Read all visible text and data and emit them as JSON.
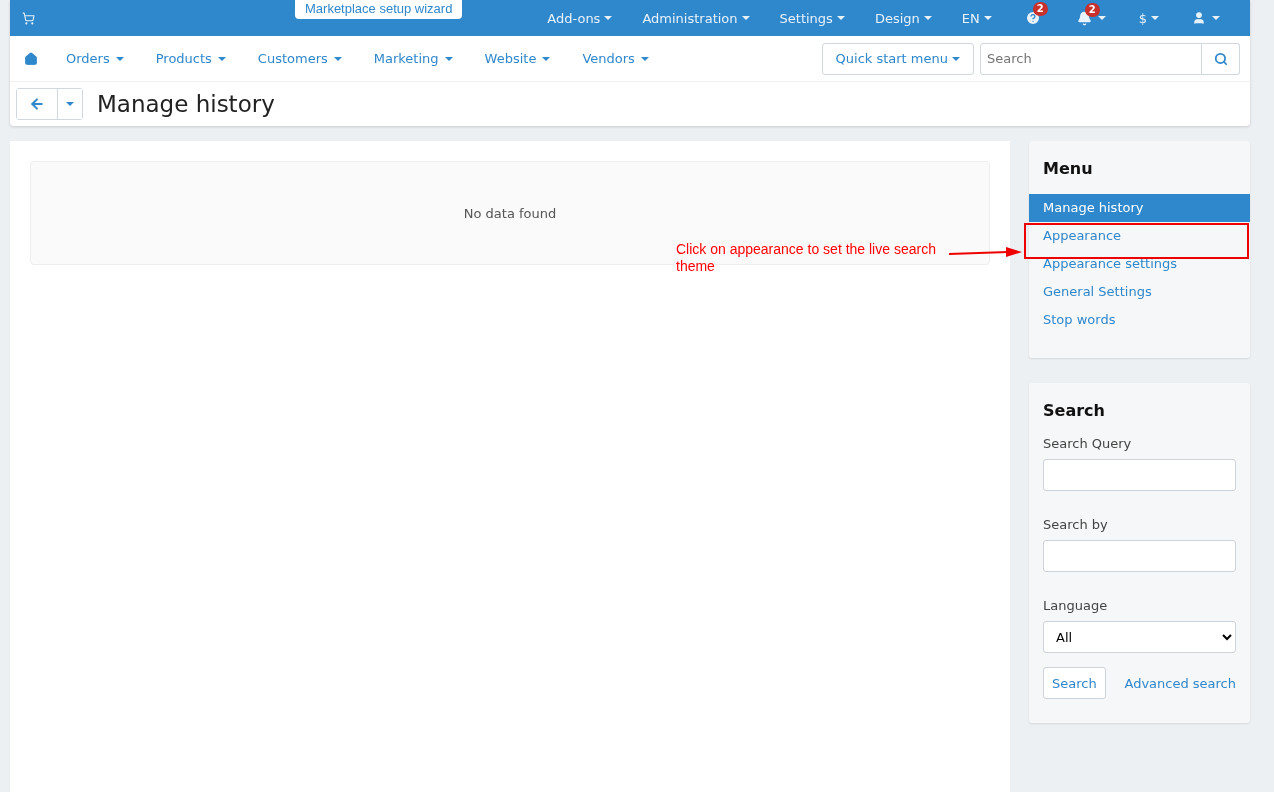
{
  "top_bar": {
    "wizard": "Marketplace setup wizard",
    "menus": [
      {
        "label": "Add-ons"
      },
      {
        "label": "Administration"
      },
      {
        "label": "Settings"
      },
      {
        "label": "Design"
      },
      {
        "label": "EN"
      }
    ],
    "help_badge": "2",
    "bell_badge": "2",
    "currency": "$"
  },
  "nav": {
    "items": [
      {
        "label": "Orders"
      },
      {
        "label": "Products"
      },
      {
        "label": "Customers"
      },
      {
        "label": "Marketing"
      },
      {
        "label": "Website"
      },
      {
        "label": "Vendors"
      }
    ],
    "quick_start": "Quick start menu",
    "search_placeholder": "Search"
  },
  "page_title": "Manage history",
  "empty_message": "No data found",
  "annotation": "Click on appearance to set the live search theme",
  "menu": {
    "title": "Menu",
    "items": [
      {
        "label": "Manage history",
        "selected": true
      },
      {
        "label": "Appearance",
        "selected": false,
        "highlighted": true
      },
      {
        "label": "Appearance settings",
        "selected": false
      },
      {
        "label": "General Settings",
        "selected": false
      },
      {
        "label": "Stop words",
        "selected": false
      }
    ]
  },
  "search_panel": {
    "title": "Search",
    "query_label": "Search Query",
    "by_label": "Search by",
    "language_label": "Language",
    "language_value": "All",
    "button": "Search",
    "advanced": "Advanced search"
  }
}
